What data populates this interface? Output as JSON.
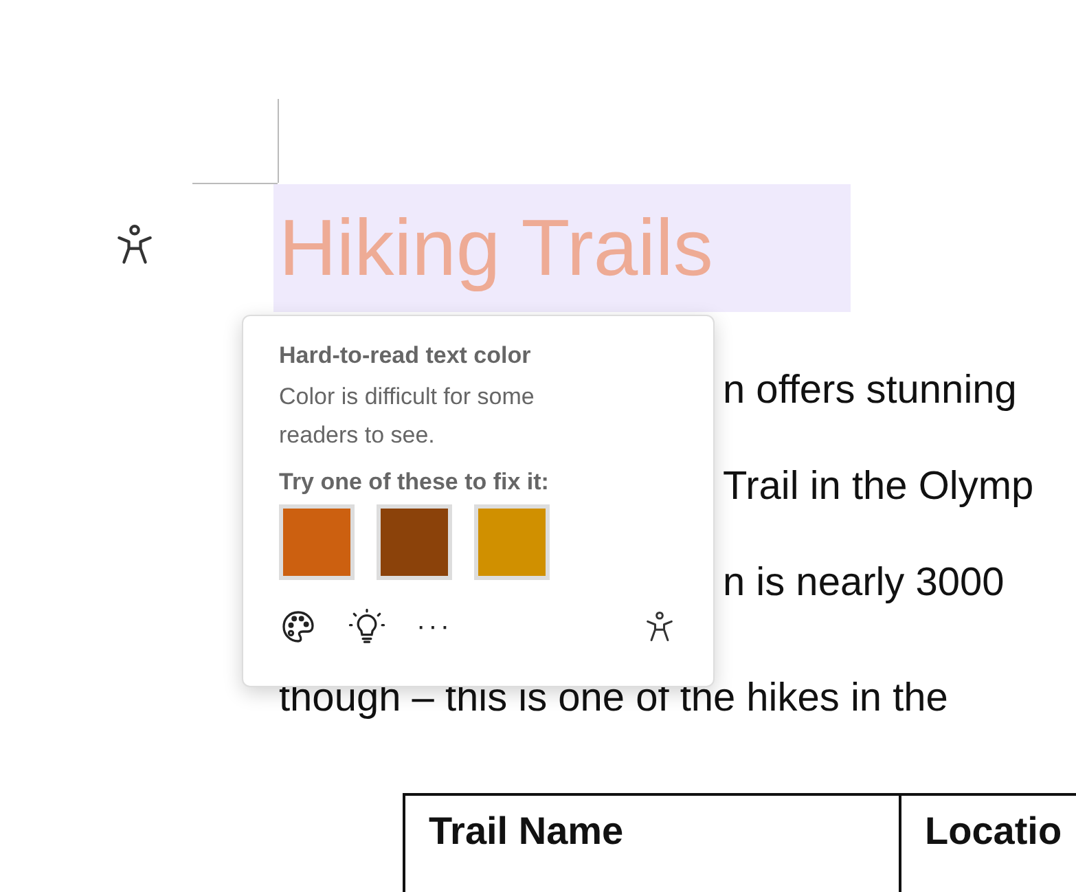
{
  "document": {
    "title": "Hiking Trails",
    "lines": [
      "n offers stunning",
      "Trail in the Olymp",
      "n is nearly 3000",
      "though – this is one of the hikes in the"
    ],
    "table": {
      "columns": [
        "Trail Name",
        "Locatio"
      ]
    }
  },
  "popup": {
    "heading": "Hard-to-read text color",
    "message": "Color is difficult for some readers to see.",
    "prompt": "Try one of these to fix it:",
    "swatches": [
      {
        "color": "#cc6010"
      },
      {
        "color": "#8b420a"
      },
      {
        "color": "#d09000"
      }
    ],
    "more": "···"
  }
}
